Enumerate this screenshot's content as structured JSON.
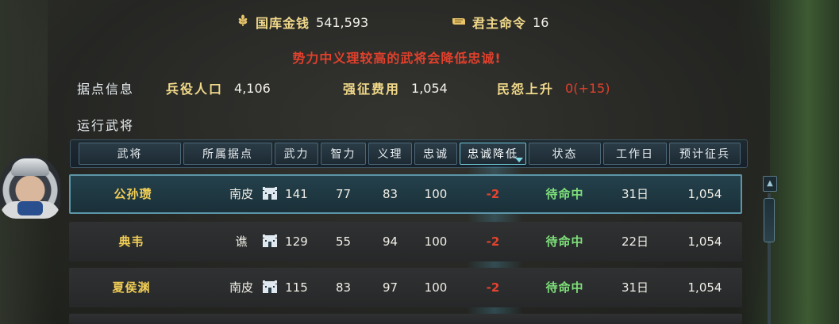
{
  "resources": {
    "treasury": {
      "icon": "wheat-icon",
      "label": "国库金钱",
      "value": "541,593"
    },
    "orders": {
      "icon": "scroll-icon",
      "label": "君主命令",
      "value": "16"
    }
  },
  "warning": "势力中义理较高的武将会降低忠诚!",
  "stronghold": {
    "title": "据点信息",
    "manpower_label": "兵役人口",
    "manpower_value": "4,106",
    "conscription_label": "强征费用",
    "conscription_value": "1,054",
    "unrest_label": "民怨上升",
    "unrest_value": "0(+15)"
  },
  "section_title": "运行武将",
  "columns": [
    "武将",
    "所属据点",
    "武力",
    "智力",
    "义理",
    "忠诚",
    "忠诚降低",
    "状态",
    "工作日",
    "预计征兵"
  ],
  "rows": [
    {
      "name": "公孙瓒",
      "base_icon": "castle-icon",
      "base": "南皮",
      "str": "141",
      "int": "77",
      "rig": "83",
      "loy": "100",
      "loy_drop": "-2",
      "status": "待命中",
      "days": "31日",
      "est": "1,054"
    },
    {
      "name": "典韦",
      "base_icon": "castle-icon",
      "base": "谯",
      "str": "129",
      "int": "55",
      "rig": "94",
      "loy": "100",
      "loy_drop": "-2",
      "status": "待命中",
      "days": "22日",
      "est": "1,054"
    },
    {
      "name": "夏侯渊",
      "base_icon": "castle-icon",
      "base": "南皮",
      "str": "115",
      "int": "83",
      "rig": "97",
      "loy": "100",
      "loy_drop": "-2",
      "status": "待命中",
      "days": "31日",
      "est": "1,054"
    }
  ],
  "colors": {
    "gold": "#f1d98a",
    "red": "#e2402c",
    "green": "#7fe07a",
    "name_yellow": "#f1cd56"
  }
}
